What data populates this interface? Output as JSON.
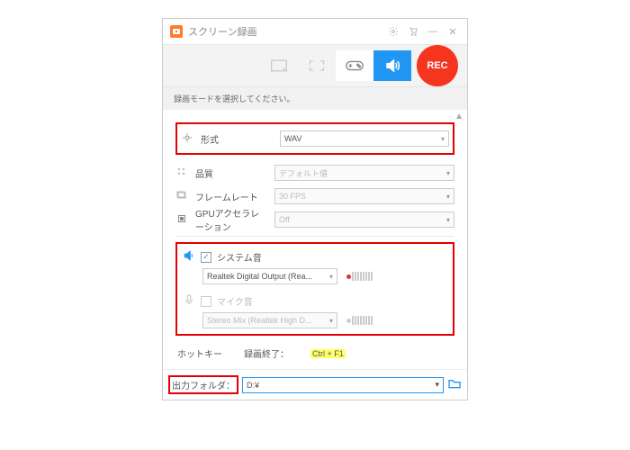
{
  "window": {
    "title": "スクリーン録画"
  },
  "rec": {
    "label": "REC"
  },
  "instruction": "録画モードを選択してください。",
  "settings": {
    "format": {
      "label": "形式",
      "value": "WAV"
    },
    "quality": {
      "label": "品質",
      "value": "デフォルト値"
    },
    "framerate": {
      "label": "フレームレート",
      "value": "30 FPS"
    },
    "gpu": {
      "label": "GPUアクセラレーション",
      "value": "Off"
    }
  },
  "audio": {
    "system": {
      "label": "システム音",
      "checked": true,
      "device": "Realtek Digital Output (Rea..."
    },
    "mic": {
      "label": "マイク音",
      "checked": false,
      "device": "Stereo Mix (Realtek High D..."
    }
  },
  "hotkey": {
    "label": "ホットキー",
    "stop_label": "録画終了：",
    "stop_key": "Ctrl + F1"
  },
  "output": {
    "label": "出力フォルダ：",
    "path": "D:¥"
  }
}
